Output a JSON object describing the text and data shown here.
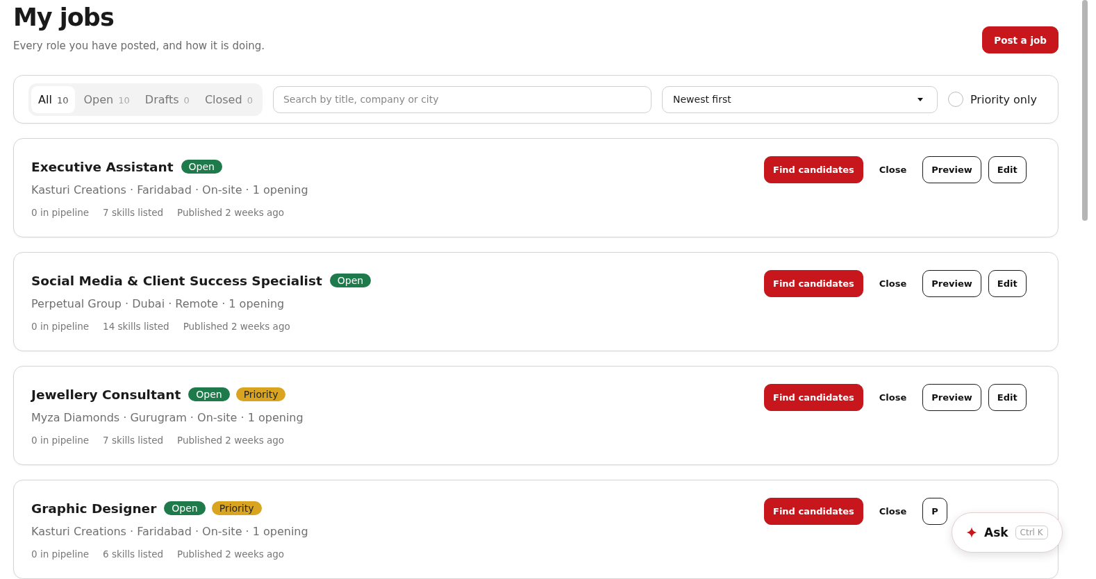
{
  "header": {
    "title": "My jobs",
    "subtitle": "Every role you have posted, and how it is doing.",
    "action": "Post a job"
  },
  "filters": {
    "tabs": [
      {
        "label": "All",
        "count": "10",
        "selected": true
      },
      {
        "label": "Open",
        "count": "10",
        "selected": false
      },
      {
        "label": "Drafts",
        "count": "0",
        "selected": false
      },
      {
        "label": "Closed",
        "count": "0",
        "selected": false
      }
    ],
    "search": {
      "placeholder": "Search by title, company or city"
    },
    "sort": {
      "value": "Newest first"
    },
    "priority_only": {
      "label": "Priority only",
      "checked": false
    }
  },
  "jobs": [
    {
      "title": "Executive Assistant",
      "tags": [
        {
          "label": "Open",
          "kind": "status"
        }
      ],
      "meta": "Kasturi Creations · Faridabad · On-site · 1 opening",
      "stats": [
        "0 in pipeline",
        "7 skills listed",
        "Published 2 weeks ago"
      ],
      "actions": [
        {
          "label": "Find candidates",
          "kind": "primary"
        },
        {
          "label": "Close",
          "kind": "plain"
        },
        {
          "label": "Preview",
          "kind": "outline"
        },
        {
          "label": "Edit",
          "kind": "outline"
        }
      ]
    },
    {
      "title": "Social Media & Client Success Specialist",
      "tags": [
        {
          "label": "Open",
          "kind": "status"
        }
      ],
      "meta": "Perpetual Group · Dubai · Remote · 1 opening",
      "stats": [
        "0 in pipeline",
        "14 skills listed",
        "Published 2 weeks ago"
      ],
      "actions": [
        {
          "label": "Find candidates",
          "kind": "primary"
        },
        {
          "label": "Close",
          "kind": "plain"
        },
        {
          "label": "Preview",
          "kind": "outline"
        },
        {
          "label": "Edit",
          "kind": "outline"
        }
      ]
    },
    {
      "title": "Jewellery Consultant",
      "tags": [
        {
          "label": "Open",
          "kind": "status"
        },
        {
          "label": "Priority",
          "kind": "priority"
        }
      ],
      "meta": "Myza Diamonds · Gurugram · On-site · 1 opening",
      "stats": [
        "0 in pipeline",
        "7 skills listed",
        "Published 2 weeks ago"
      ],
      "actions": [
        {
          "label": "Find candidates",
          "kind": "primary"
        },
        {
          "label": "Close",
          "kind": "plain"
        },
        {
          "label": "Preview",
          "kind": "outline"
        },
        {
          "label": "Edit",
          "kind": "outline"
        }
      ]
    },
    {
      "title": "Graphic Designer",
      "tags": [
        {
          "label": "Open",
          "kind": "status"
        },
        {
          "label": "Priority",
          "kind": "priority"
        }
      ],
      "meta": "Kasturi Creations · Faridabad · On-site · 1 opening",
      "stats": [
        "0 in pipeline",
        "6 skills listed",
        "Published 2 weeks ago"
      ],
      "actions": [
        {
          "label": "Find candidates",
          "kind": "primary"
        },
        {
          "label": "Close",
          "kind": "plain"
        },
        {
          "label": "P",
          "kind": "outline"
        }
      ]
    }
  ],
  "assistant": {
    "label": "Ask",
    "shortcut": "Ctrl K"
  }
}
